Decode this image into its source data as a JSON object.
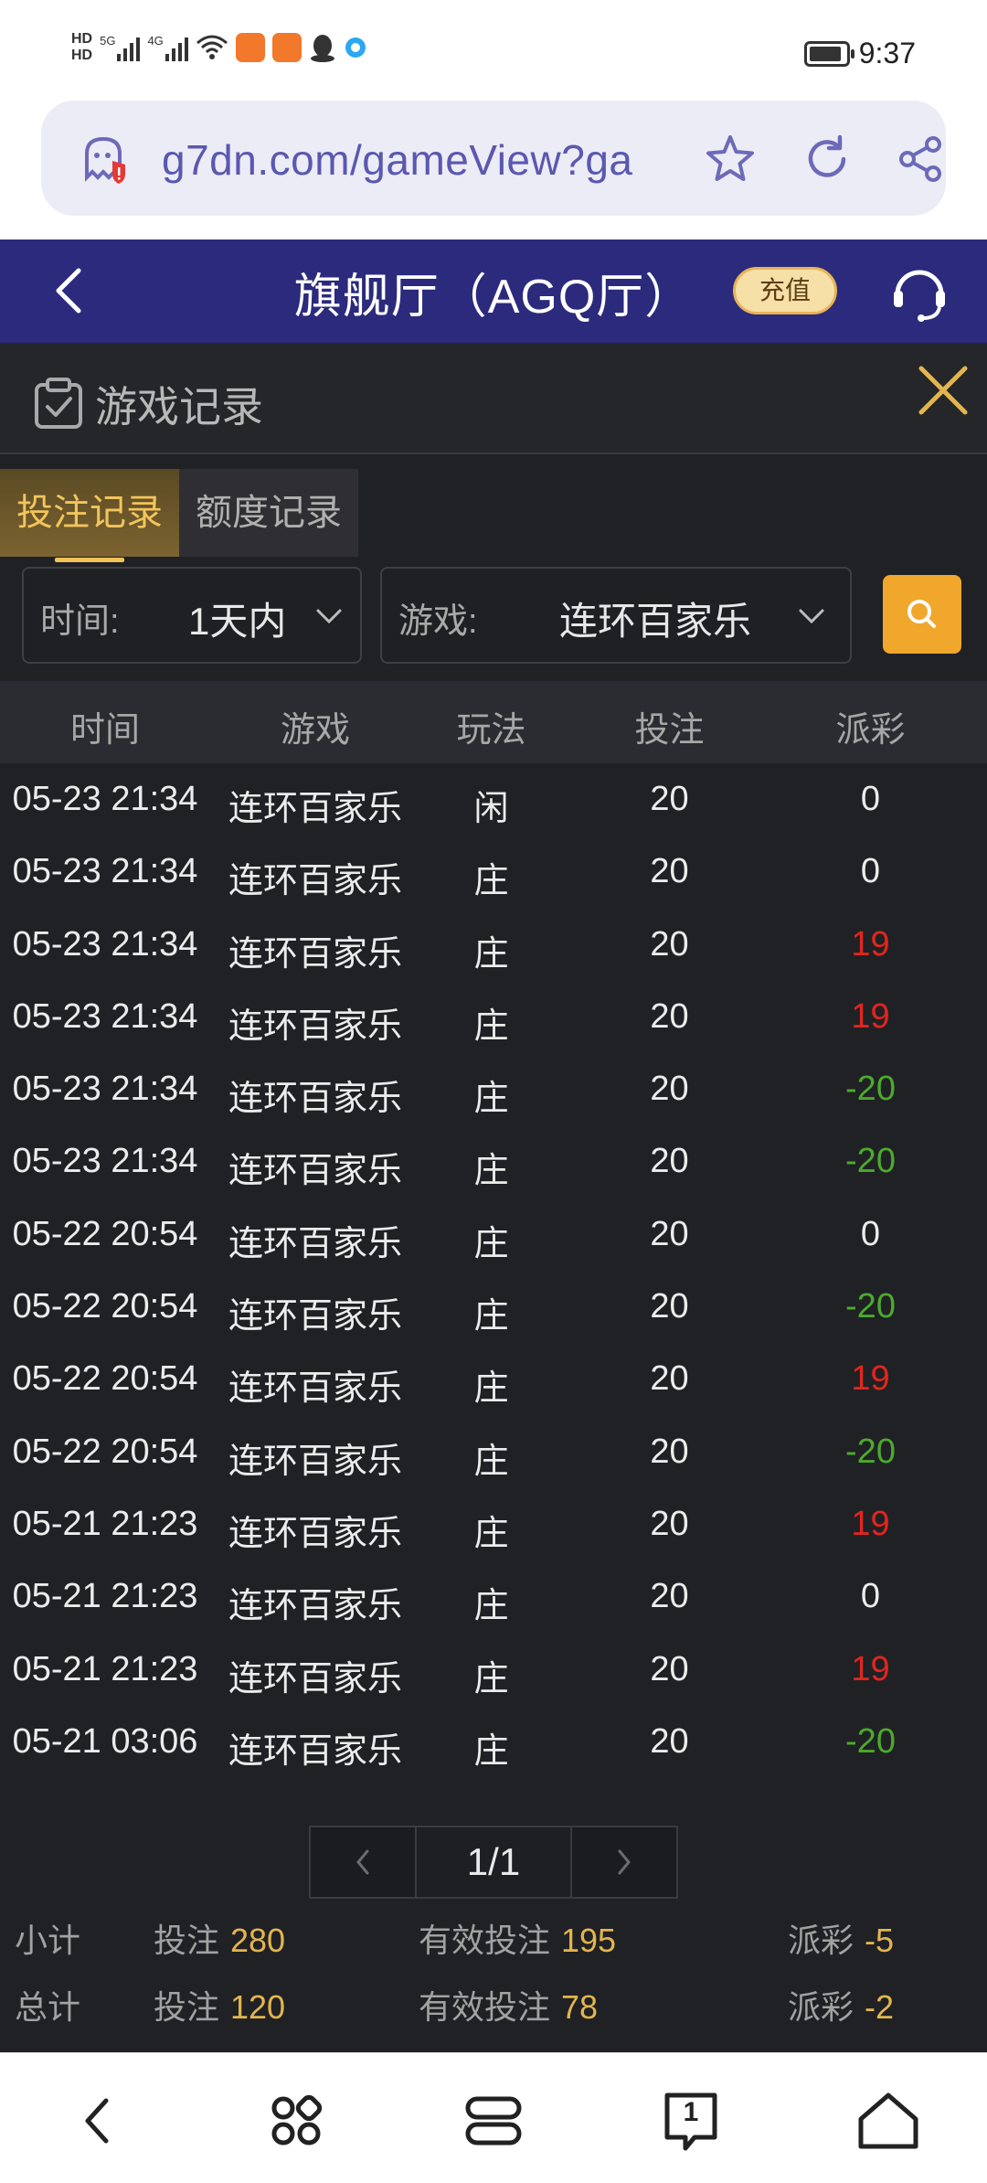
{
  "status_bar": {
    "hd1": "HD",
    "hd2": "HD",
    "net1": "5G",
    "net2": "4G",
    "time": "9:37",
    "icons": [
      "signal-icon",
      "wifi-icon",
      "app-icon-orange",
      "app-icon-orange",
      "qq-icon",
      "browser-dot-icon",
      "battery-icon"
    ]
  },
  "browser": {
    "url": "g7dn.com/gameView?ga"
  },
  "header": {
    "title": "旗舰厅（AGQ厅）",
    "recharge": "充值"
  },
  "records_panel": {
    "title": "游戏记录",
    "tabs": [
      {
        "label": "投注记录",
        "active": true
      },
      {
        "label": "额度记录",
        "active": false
      }
    ],
    "filters": {
      "time_label": "时间:",
      "time_value": "1天内",
      "game_label": "游戏:",
      "game_value": "连环百家乐"
    },
    "columns": [
      "时间",
      "游戏",
      "玩法",
      "投注",
      "派彩"
    ],
    "rows": [
      {
        "time": "05-23 21:34",
        "game": "连环百家乐",
        "play": "闲",
        "bet": "20",
        "payout": "0"
      },
      {
        "time": "05-23 21:34",
        "game": "连环百家乐",
        "play": "庄",
        "bet": "20",
        "payout": "0"
      },
      {
        "time": "05-23 21:34",
        "game": "连环百家乐",
        "play": "庄",
        "bet": "20",
        "payout": "19"
      },
      {
        "time": "05-23 21:34",
        "game": "连环百家乐",
        "play": "庄",
        "bet": "20",
        "payout": "19"
      },
      {
        "time": "05-23 21:34",
        "game": "连环百家乐",
        "play": "庄",
        "bet": "20",
        "payout": "-20"
      },
      {
        "time": "05-23 21:34",
        "game": "连环百家乐",
        "play": "庄",
        "bet": "20",
        "payout": "-20"
      },
      {
        "time": "05-22 20:54",
        "game": "连环百家乐",
        "play": "庄",
        "bet": "20",
        "payout": "0"
      },
      {
        "time": "05-22 20:54",
        "game": "连环百家乐",
        "play": "庄",
        "bet": "20",
        "payout": "-20"
      },
      {
        "time": "05-22 20:54",
        "game": "连环百家乐",
        "play": "庄",
        "bet": "20",
        "payout": "19"
      },
      {
        "time": "05-22 20:54",
        "game": "连环百家乐",
        "play": "庄",
        "bet": "20",
        "payout": "-20"
      },
      {
        "time": "05-21 21:23",
        "game": "连环百家乐",
        "play": "庄",
        "bet": "20",
        "payout": "19"
      },
      {
        "time": "05-21 21:23",
        "game": "连环百家乐",
        "play": "庄",
        "bet": "20",
        "payout": "0"
      },
      {
        "time": "05-21 21:23",
        "game": "连环百家乐",
        "play": "庄",
        "bet": "20",
        "payout": "19"
      },
      {
        "time": "05-21 03:06",
        "game": "连环百家乐",
        "play": "庄",
        "bet": "20",
        "payout": "-20"
      }
    ],
    "pagination": {
      "current": "1/1"
    },
    "subtotal": {
      "label": "小计",
      "bet_label": "投注",
      "bet": "280",
      "valid_label": "有效投注",
      "valid": "195",
      "payout_label": "派彩",
      "payout": "-5"
    },
    "total": {
      "label": "总计",
      "bet_label": "投注",
      "bet": "120",
      "valid_label": "有效投注",
      "valid": "78",
      "payout_label": "派彩",
      "payout": "-2"
    }
  },
  "colors": {
    "header_bg": "#2b2a7c",
    "gold": "#f0c25a",
    "positive": "#e0261e",
    "negative": "#4caa2c",
    "neutral": "#ececec"
  },
  "nav": {
    "tab_count": "1",
    "icons": [
      "back-icon",
      "apps-icon",
      "menu-icon",
      "tabs-icon",
      "home-icon"
    ]
  }
}
